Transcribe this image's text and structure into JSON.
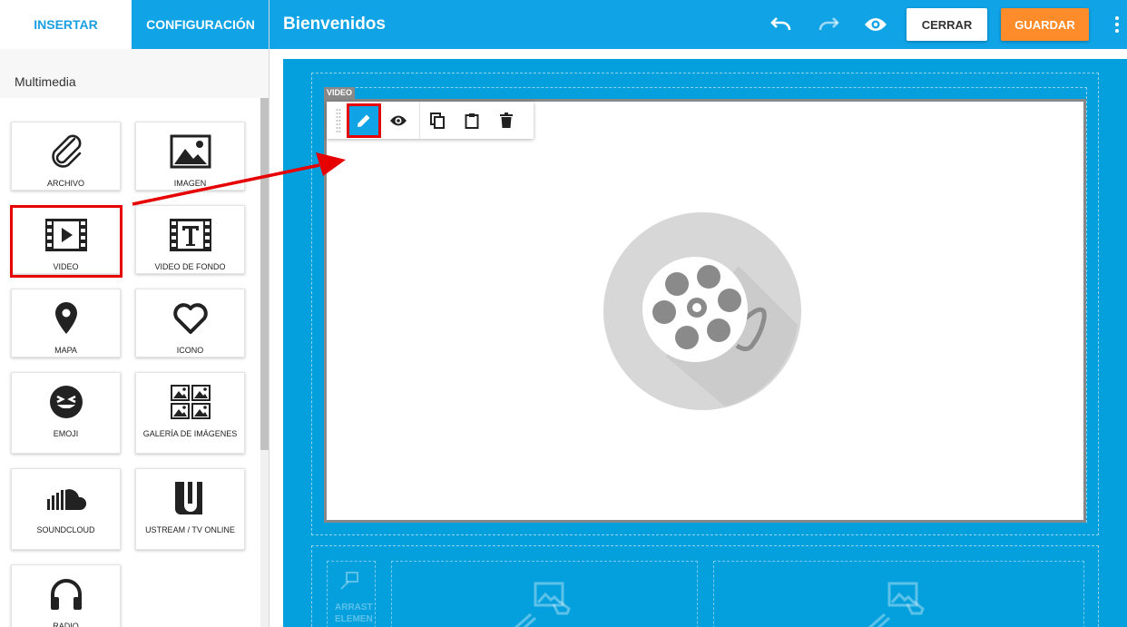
{
  "sidebar": {
    "tabs": {
      "insert": "INSERTAR",
      "config": "CONFIGURACIÓN"
    },
    "section_title": "Multimedia",
    "widgets": [
      {
        "label": "ARCHIVO",
        "icon": "paperclip-icon"
      },
      {
        "label": "IMAGEN",
        "icon": "image-icon"
      },
      {
        "label": "VIDEO",
        "icon": "video-film-icon"
      },
      {
        "label": "VIDEO DE FONDO",
        "icon": "video-background-icon"
      },
      {
        "label": "MAPA",
        "icon": "map-pin-icon"
      },
      {
        "label": "ICONO",
        "icon": "heart-icon"
      },
      {
        "label": "EMOJI",
        "icon": "emoji-icon"
      },
      {
        "label": "GALERÍA DE IMÁGENES",
        "icon": "gallery-icon"
      },
      {
        "label": "SOUNDCLOUD",
        "icon": "soundcloud-icon"
      },
      {
        "label": "USTREAM / TV ONLINE",
        "icon": "ustream-icon"
      },
      {
        "label": "RADIO",
        "icon": "headphones-icon"
      }
    ]
  },
  "header": {
    "title": "Bienvenidos",
    "close_label": "CERRAR",
    "save_label": "GUARDAR"
  },
  "canvas": {
    "element_tag": "VIDEO",
    "drop_text_line1": "ARRAST",
    "drop_text_line2": "ELEMEN"
  },
  "colors": {
    "brand_blue": "#10a3e6",
    "canvas_blue": "#04a0dd",
    "save_orange": "#ff8c2b",
    "highlight_red": "#e60000"
  }
}
